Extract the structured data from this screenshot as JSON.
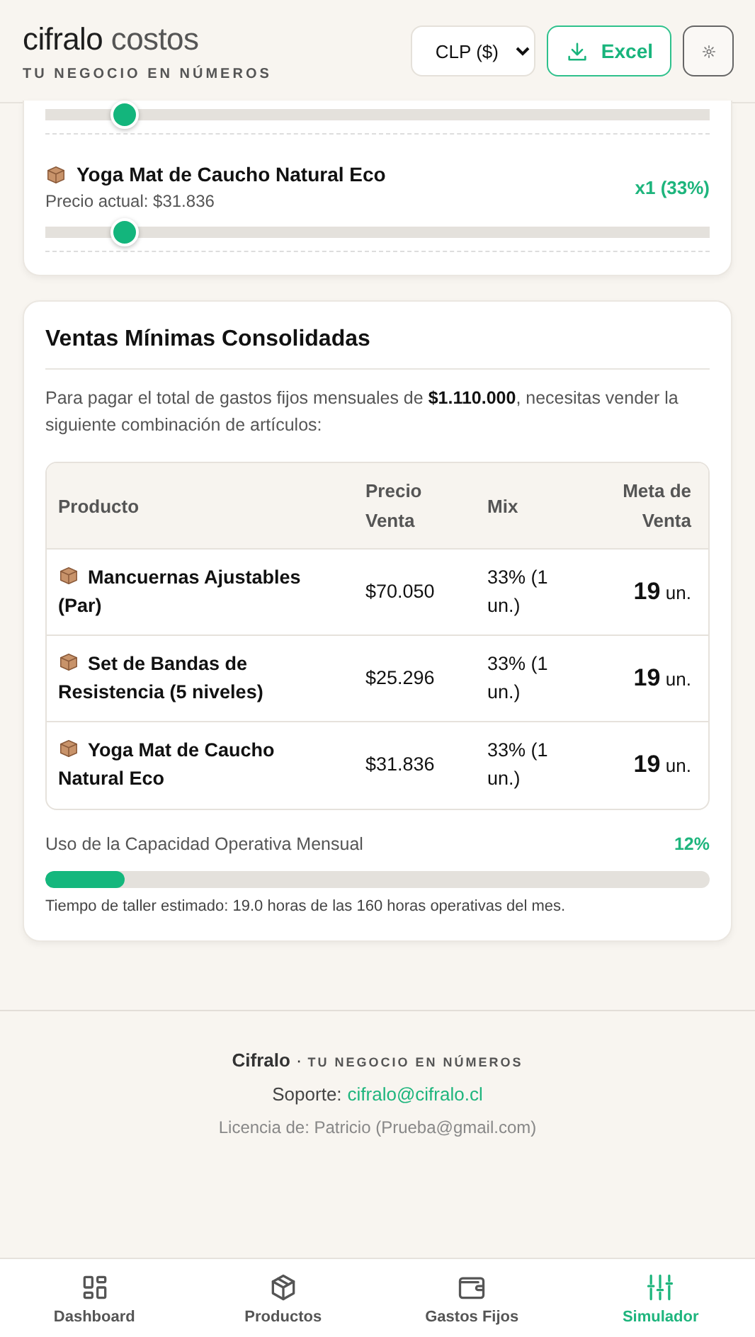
{
  "header": {
    "brand": "cifralo",
    "brand_suffix": "costos",
    "tagline": "TU NEGOCIO EN NÚMEROS",
    "currency": "CLP ($)",
    "export_button": "Excel"
  },
  "mix_card": {
    "items": [
      {
        "kind": "slider",
        "level": 0.12
      },
      {
        "kind": "product",
        "name": "Yoga Mat de Caucho Natural Eco",
        "price": "Precio actual: $31.836",
        "share": "x1 (33%)",
        "level": 0.12
      }
    ]
  },
  "summary": {
    "title": "Ventas Mínimas Consolidadas",
    "description": "Para pagar el total de gastos fijos mensuales de **$1.110.000**, necesitas vender la siguiente combinación de artículos:",
    "table": {
      "columns": [
        "Producto",
        "Precio Venta",
        "Mix",
        "Meta de Venta"
      ],
      "rows": [
        {
          "product": "Mancuernas Ajustables (Par)",
          "price": "$70.050",
          "mix": "33% (1 un.)",
          "goal": "19",
          "unit": "un."
        },
        {
          "product": "Set de Bandas de Resistencia (5 niveles)",
          "price": "$25.296",
          "mix": "33% (1 un.)",
          "goal": "19",
          "unit": "un."
        },
        {
          "product": "Yoga Mat de Caucho Natural Eco",
          "price": "$31.836",
          "mix": "33% (1 un.)",
          "goal": "19",
          "unit": "un."
        }
      ]
    },
    "capacity": {
      "label": "Uso de la Capacidad Operativa Mensual",
      "value": "12%",
      "level": 0.12,
      "note": "Tiempo de taller estimado: 19.0 horas de las 160 horas operativas del mes."
    }
  },
  "footer": {
    "brand": "Cifralo",
    "separator": "·",
    "tagline": "TU NEGOCIO EN NÚMEROS",
    "support_label": "Soporte:",
    "support_email": "cifralo@cifralo.cl",
    "license": "Licencia de: Patricio (Prueba@gmail.com)"
  },
  "bottom_nav": [
    {
      "kind": "grid",
      "label": "Dashboard",
      "selected": false
    },
    {
      "kind": "box",
      "label": "Productos",
      "selected": false
    },
    {
      "kind": "wallet",
      "label": "Gastos Fijos",
      "selected": false
    },
    {
      "kind": "sliders",
      "label": "Simulador",
      "selected": true
    }
  ]
}
